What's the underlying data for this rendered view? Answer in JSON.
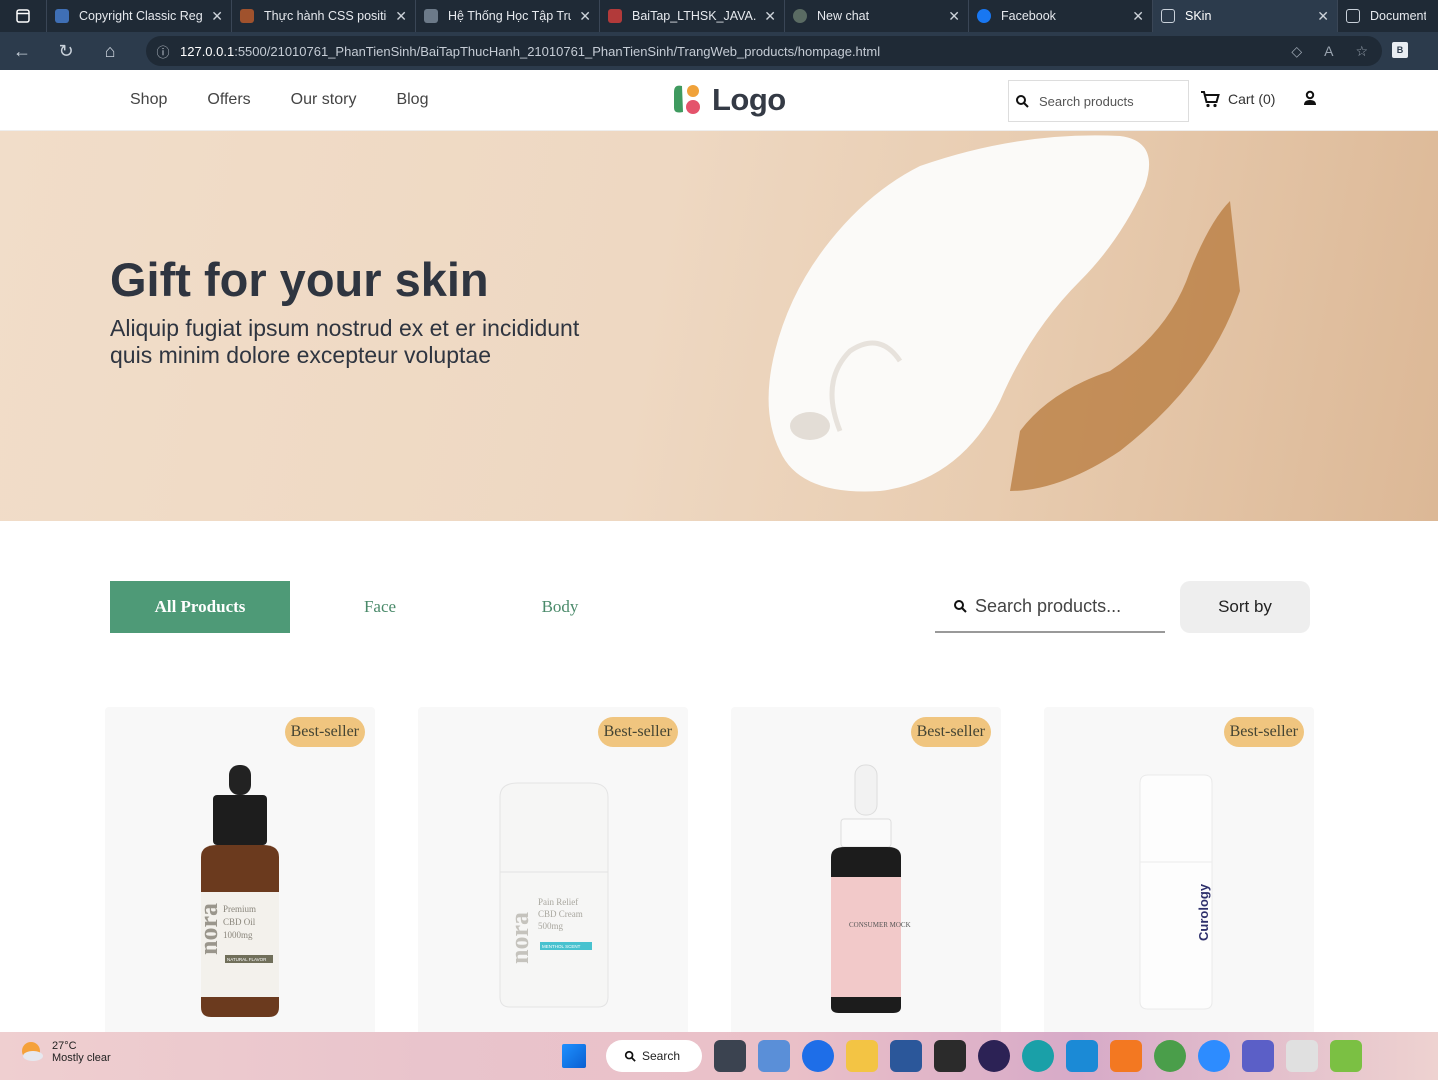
{
  "browser": {
    "tabs": [
      {
        "title": "Copyright Classic Regu",
        "color": "#3f6fb5",
        "active": false
      },
      {
        "title": "Thực hành CSS positio",
        "color": "#a0522d",
        "active": false
      },
      {
        "title": "Hệ Thống Học Tập Tru",
        "color": "#6c7a89",
        "active": false
      },
      {
        "title": "BaiTap_LTHSK_JAVA.pd",
        "color": "#b23a3a",
        "active": false
      },
      {
        "title": "New chat",
        "color": "#5a6b63",
        "active": false
      },
      {
        "title": "Facebook",
        "color": "#1877f2",
        "active": false
      },
      {
        "title": "SKin",
        "color": "#c9d1da",
        "active": true
      },
      {
        "title": "Document",
        "color": "#c9d1da",
        "active": false
      }
    ],
    "url_host": "127.0.0.1",
    "url_rest": ":5500/21010761_PhanTienSinh/BaiTapThucHanh_21010761_PhanTienSinh/TrangWeb_products/hompage.html",
    "extension_label": "B"
  },
  "header": {
    "menu": [
      "Shop",
      "Offers",
      "Our story",
      "Blog"
    ],
    "logo_text": "Logo",
    "search_placeholder": "Search products",
    "cart_label": "Cart (0)"
  },
  "hero": {
    "title": "Gift for your skin",
    "subtitle": "Aliquip fugiat ipsum nostrud ex et er incididunt quis minim dolore excepteur voluptae"
  },
  "filters": {
    "tabs": [
      "All Products",
      "Face",
      "Body"
    ],
    "active": "All Products",
    "search_placeholder": "Search products...",
    "sort_label": "Sort by"
  },
  "products": [
    {
      "badge": "Best-seller",
      "brand": "nora",
      "name": "Premium CBD Oil 1000mg",
      "tag": "NATURAL FLAVOR"
    },
    {
      "badge": "Best-seller",
      "brand": "nora",
      "name": "Pain Relief CBD Cream 500mg",
      "tag": "MENTHOL SCENT"
    },
    {
      "badge": "Best-seller",
      "brand": "",
      "name": "CONSUMER MOCK",
      "tag": ""
    },
    {
      "badge": "Best-seller",
      "brand": "Curology",
      "name": "",
      "tag": ""
    }
  ],
  "taskbar": {
    "temperature": "27°C",
    "weather": "Mostly clear",
    "search_label": "Search"
  },
  "colors": {
    "accent_green": "#4e9a77",
    "badge": "#f0c57f",
    "browser_bg": "#1f2a36"
  }
}
